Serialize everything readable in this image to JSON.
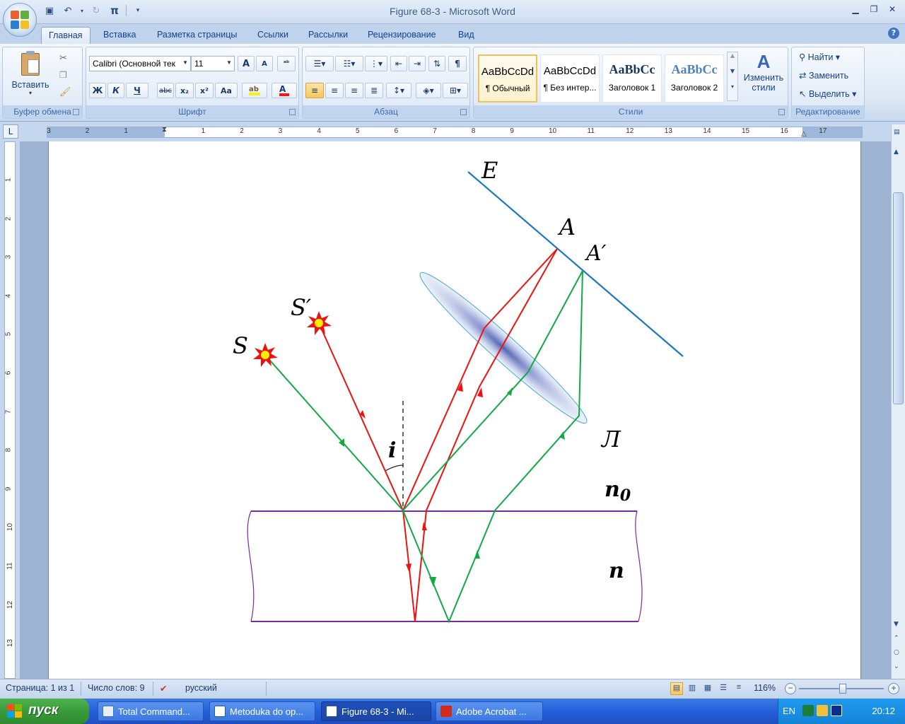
{
  "window": {
    "title": "Figure 68-3 - Microsoft Word"
  },
  "qat": {
    "pi_label": "π"
  },
  "tabs": [
    "Главная",
    "Вставка",
    "Разметка страницы",
    "Ссылки",
    "Рассылки",
    "Рецензирование",
    "Вид"
  ],
  "clipboard": {
    "paste_label": "Вставить",
    "group_label": "Буфер обмена"
  },
  "font": {
    "family": "Calibri (Основной тек",
    "size": "11",
    "group_label": "Шрифт",
    "bold": "Ж",
    "italic": "К",
    "underline": "Ч",
    "strike": "abc",
    "sub": "x₂",
    "sup": "x²",
    "case": "Aa",
    "grow": "A",
    "shrink": "A",
    "color_letter": "A"
  },
  "paragraph": {
    "group_label": "Абзац",
    "pilcrow": "¶"
  },
  "styles": {
    "group_label": "Стили",
    "change_label_1": "Изменить",
    "change_label_2": "стили",
    "tiles": [
      {
        "sample": "AaBbCcDd",
        "name": "¶ Обычный"
      },
      {
        "sample": "AaBbCcDd",
        "name": "¶ Без интер..."
      },
      {
        "sample": "AaBbCc",
        "name": "Заголовок 1"
      },
      {
        "sample": "AaBbCc",
        "name": "Заголовок 2"
      }
    ]
  },
  "editing": {
    "find": "Найти",
    "replace": "Заменить",
    "select": "Выделить",
    "group_label": "Редактирование"
  },
  "ruler": {
    "h_labels": [
      "3",
      "2",
      "1",
      "1",
      "2",
      "3",
      "4",
      "5",
      "6",
      "7",
      "8",
      "9",
      "10",
      "11",
      "12",
      "13",
      "14",
      "15",
      "16",
      "17"
    ],
    "v_labels": [
      "1",
      "2",
      "3",
      "4",
      "5",
      "6",
      "7",
      "8",
      "9",
      "10",
      "11",
      "12",
      "13"
    ]
  },
  "figure": {
    "label_E": "E",
    "label_A": "A",
    "label_A_prime": "A′",
    "label_L": "Л",
    "label_S": "S",
    "label_S_prime": "S′",
    "label_i": "i",
    "label_n0_base": "n",
    "label_n0_sub": "0",
    "label_n": "n",
    "colors": {
      "red": "#ee1111",
      "green": "#11aa44",
      "blue": "#1a78c2",
      "purple": "#7a2aa0",
      "lens": "#7d8ec9"
    }
  },
  "status": {
    "page": "Страница: 1 из 1",
    "words": "Число слов: 9",
    "language": "русский",
    "zoom": "116%"
  },
  "taskbar": {
    "start": "пуск",
    "tasks": [
      "Total Command...",
      "Metoduka do op...",
      "Figure 68-3 - Mi...",
      "Adobe Acrobat ..."
    ],
    "lang": "EN",
    "time": "20:12"
  }
}
